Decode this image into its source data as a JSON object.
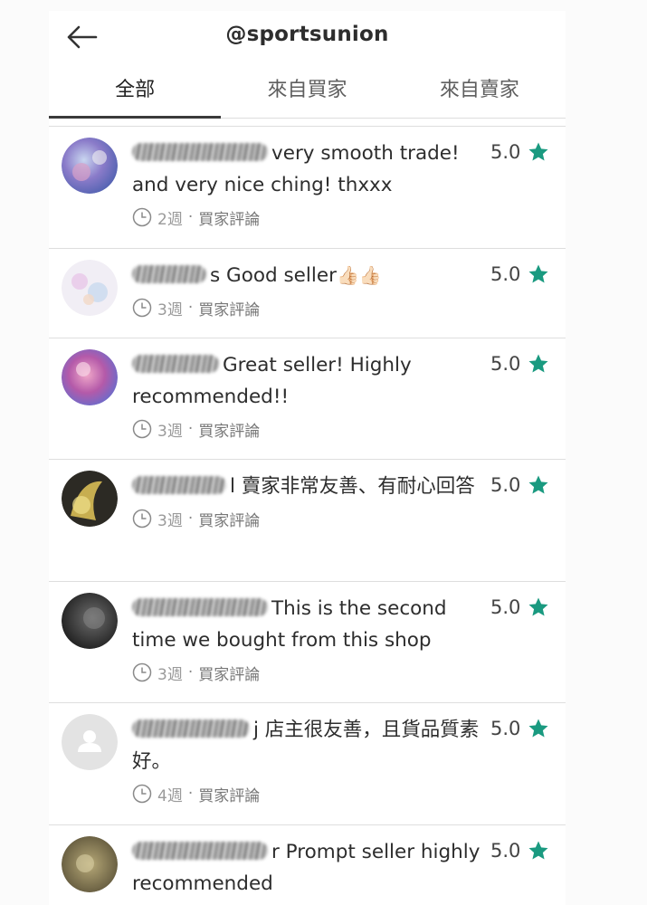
{
  "header": {
    "title": "@sportsunion"
  },
  "tabs": [
    {
      "label": "全部",
      "active": true
    },
    {
      "label": "來自買家",
      "active": false
    },
    {
      "label": "來自賣家",
      "active": false
    }
  ],
  "colors": {
    "star": "#1a9a80",
    "tab_indicator": "#3a3a3a"
  },
  "reviews": [
    {
      "text": "very smooth trade! and very nice ching! thxxx",
      "rating": "5.0",
      "time": "2週",
      "type": "買家評論"
    },
    {
      "text": "s Good seller",
      "emoji": "👍🏻👍🏻",
      "rating": "5.0",
      "time": "3週",
      "type": "買家評論"
    },
    {
      "text": "Great seller! Highly recommended!!",
      "rating": "5.0",
      "time": "3週",
      "type": "買家評論"
    },
    {
      "text": "l 賣家非常友善、有耐心回答",
      "rating": "5.0",
      "time": "3週",
      "type": "買家評論"
    },
    {
      "text": "This is the second time we bought from this shop",
      "rating": "5.0",
      "time": "3週",
      "type": "買家評論"
    },
    {
      "text": "j 店主很友善，且貨品質素好。",
      "rating": "5.0",
      "time": "4週",
      "type": "買家評論"
    },
    {
      "text": "r Prompt seller highly recommended",
      "rating": "5.0",
      "time": "",
      "type": ""
    }
  ]
}
